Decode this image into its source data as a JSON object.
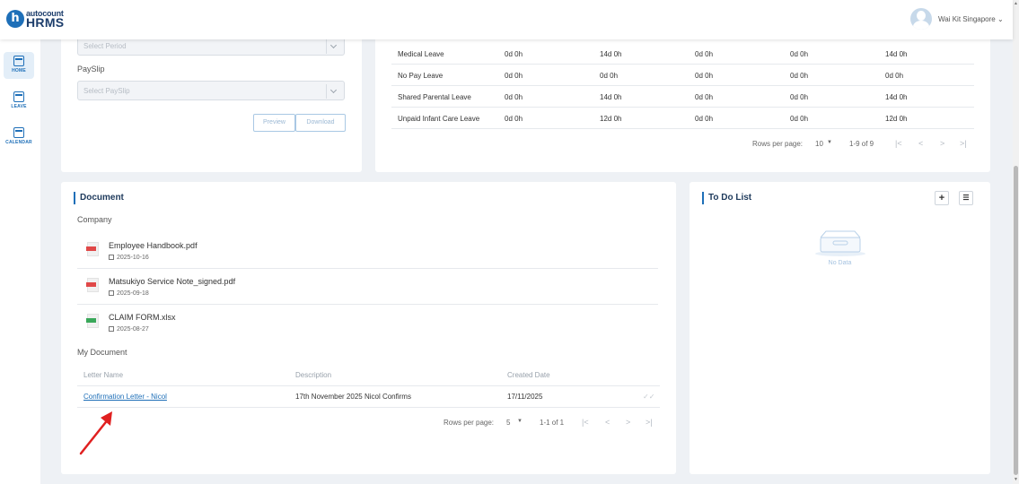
{
  "header": {
    "logo_top": "autocount",
    "logo_bottom": "HRMS",
    "user": "Wai Kit Singapore ⌄"
  },
  "sidebar": {
    "items": [
      {
        "label": "HOME"
      },
      {
        "label": "LEAVE"
      },
      {
        "label": "CALENDAR"
      }
    ]
  },
  "payslip": {
    "period_placeholder": "Select Period",
    "payslip_label": "PaySlip",
    "payslip_placeholder": "Select PaySlip",
    "preview_label": "Preview",
    "download_label": "Download"
  },
  "leave": {
    "rows": [
      [
        "Medical Leave",
        "0d 0h",
        "14d 0h",
        "0d 0h",
        "0d 0h",
        "14d 0h"
      ],
      [
        "No Pay Leave",
        "0d 0h",
        "0d 0h",
        "0d 0h",
        "0d 0h",
        "0d 0h"
      ],
      [
        "Shared Parental Leave",
        "0d 0h",
        "14d 0h",
        "0d 0h",
        "0d 0h",
        "14d 0h"
      ],
      [
        "Unpaid Infant Care Leave",
        "0d 0h",
        "12d 0h",
        "0d 0h",
        "0d 0h",
        "12d 0h"
      ]
    ],
    "rows_per_page_label": "Rows per page:",
    "rows_per_page": "10",
    "range": "1-9 of 9"
  },
  "document": {
    "title": "Document",
    "company_label": "Company",
    "files": [
      {
        "name": "Employee Handbook.pdf",
        "date": "2025-10-16",
        "color": "#e04848"
      },
      {
        "name": "Matsukiyo Service Note_signed.pdf",
        "date": "2025-09-18",
        "color": "#e04848"
      },
      {
        "name": "CLAIM FORM.xlsx",
        "date": "2025-08-27",
        "color": "#3aa85a"
      }
    ],
    "my_document_label": "My Document",
    "columns": [
      "Letter Name",
      "Description",
      "Created Date"
    ],
    "rows": [
      {
        "letter": "Confirmation Letter - Nicol",
        "description": "17th November 2025 Nicol Confirms",
        "date": "17/11/2025"
      }
    ],
    "rows_per_page_label": "Rows per page:",
    "rows_per_page": "5",
    "range": "1-1 of 1"
  },
  "todo": {
    "title": "To Do List",
    "empty_text": "No Data"
  },
  "colors": {
    "accent": "#1e6fb8",
    "annotation_arrow": "#e02020"
  }
}
